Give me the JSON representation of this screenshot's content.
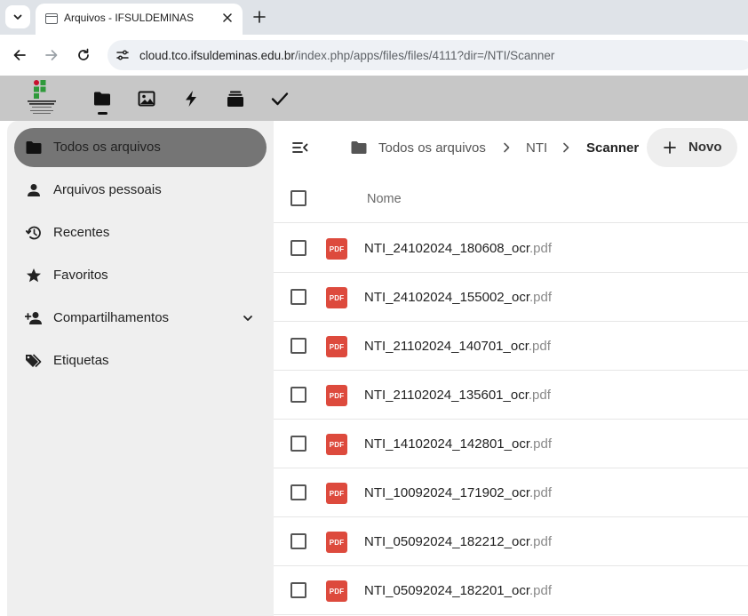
{
  "browser": {
    "tab_title": "Arquivos - IFSULDEMINAS",
    "url_host": "cloud.tco.ifsuldeminas.edu.br",
    "url_path": "/index.php/apps/files/files/4111?dir=/NTI/Scanner"
  },
  "header": {
    "logo_text": "INSTITUTO FEDERAL Sul de Minas Gerais Campus Avançado Três Corações",
    "apps": [
      "files-icon",
      "photos-icon",
      "activity-icon",
      "deck-icon",
      "tasks-icon"
    ],
    "background": "#c7c7c7"
  },
  "sidebar": {
    "items": [
      {
        "label": "Todos os arquivos",
        "icon": "folder-icon",
        "active": true
      },
      {
        "label": "Arquivos pessoais",
        "icon": "person-icon"
      },
      {
        "label": "Recentes",
        "icon": "history-icon"
      },
      {
        "label": "Favoritos",
        "icon": "star-icon"
      },
      {
        "label": "Compartilhamentos",
        "icon": "share-person-icon",
        "expandable": true
      },
      {
        "label": "Etiquetas",
        "icon": "tags-icon"
      }
    ]
  },
  "breadcrumb": {
    "items": [
      "Todos os arquivos",
      "NTI",
      "Scanner"
    ]
  },
  "new_button": {
    "label": "Novo"
  },
  "table": {
    "column_name": "Nome",
    "file_type_badge": "PDF",
    "pdf_color": "#dd4a3d",
    "files": [
      {
        "base": "NTI_24102024_180608_ocr",
        "ext": ".pdf"
      },
      {
        "base": "NTI_24102024_155002_ocr",
        "ext": ".pdf"
      },
      {
        "base": "NTI_21102024_140701_ocr",
        "ext": ".pdf"
      },
      {
        "base": "NTI_21102024_135601_ocr",
        "ext": ".pdf"
      },
      {
        "base": "NTI_14102024_142801_ocr",
        "ext": ".pdf"
      },
      {
        "base": "NTI_10092024_171902_ocr",
        "ext": ".pdf"
      },
      {
        "base": "NTI_05092024_182212_ocr",
        "ext": ".pdf"
      },
      {
        "base": "NTI_05092024_182201_ocr",
        "ext": ".pdf"
      }
    ]
  }
}
